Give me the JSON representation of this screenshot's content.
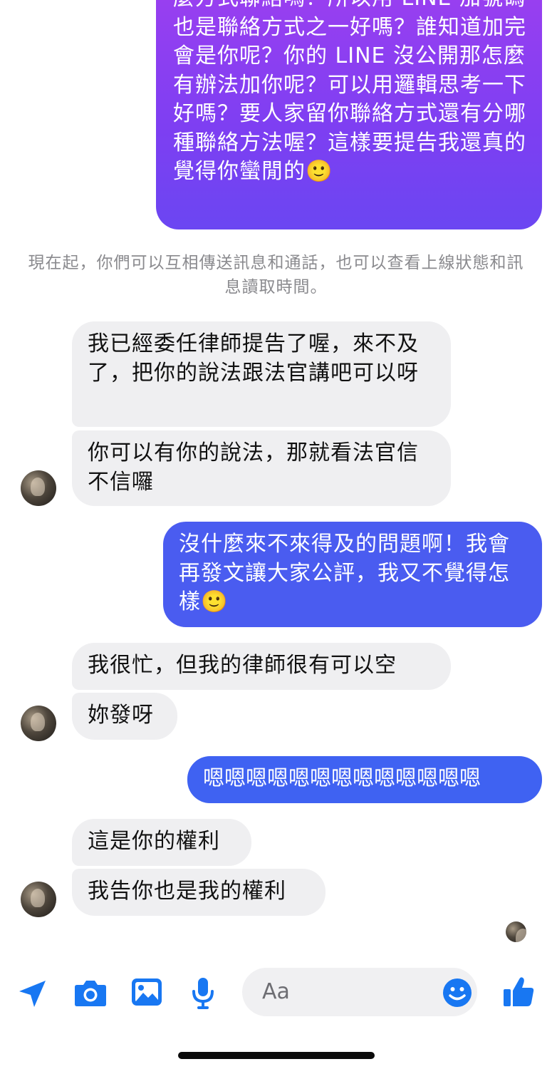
{
  "messages": {
    "m1": "麼方式聯絡嗎？所以用 LINE 加號碼也是聯絡方式之一好嗎？誰知道加完會是你呢？你的 LINE 沒公開那怎麼有辦法加你呢？可以用邏輯思考一下好嗎？要人家留你聯絡方式還有分哪種聯絡方法喔？這樣要提告我還真的覺得你蠻閒的🙂",
    "system_notice": "現在起，你們可以互相傳送訊息和通話，也可以查看上線狀態和訊息讀取時間。",
    "m2": "我已經委任律師提告了喔，來不及了，把你的說法跟法官講吧可以呀",
    "m3": "你可以有你的說法，那就看法官信不信囉",
    "m4": "沒什麼來不來得及的問題啊！我會再發文讓大家公評，我又不覺得怎樣🙂",
    "m5": "我很忙，但我的律師很有可以空",
    "m6": "妳發呀",
    "m7": "嗯嗯嗯嗯嗯嗯嗯嗯嗯嗯嗯嗯嗯",
    "m8": "這是你的權利",
    "m9": "我告你也是我的權利"
  },
  "composer": {
    "placeholder": "Aa",
    "icons": [
      "location-arrow-icon",
      "camera-icon",
      "image-icon",
      "microphone-icon",
      "emoji-icon",
      "thumbs-up-icon"
    ]
  },
  "colors": {
    "accent": "#1877f2",
    "outgoing_purple": "#8a3ff0",
    "outgoing_blue": "#4d5ef0",
    "incoming_bg": "#efeff1"
  }
}
